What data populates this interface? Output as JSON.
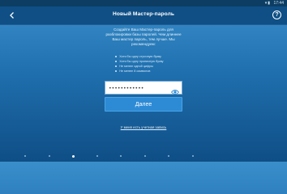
{
  "status": {
    "time": "17:44",
    "signal": "▾▮"
  },
  "appbar": {
    "back_icon": "back-arrow-icon",
    "title": "Новый Мастер-пароль",
    "help_label": "?"
  },
  "instructions": "Создайте Ваш Мастер-пароль для разблокировки базы паролей. Чем длиннее Ваш мастер пароль, тем лучше. Мы рекомендуем:",
  "requirements": [
    "Хотя бы одну строчную букву",
    "Хотя бы одну прописную букву",
    "Не менее одной цифры",
    "Не менее 8 символов"
  ],
  "password": {
    "value": "••••••••••••",
    "placeholder": ""
  },
  "next_button": "Далее",
  "existing_account_link": "У меня есть учетная запись",
  "pagination": {
    "pages": 8,
    "active_index": 2
  }
}
